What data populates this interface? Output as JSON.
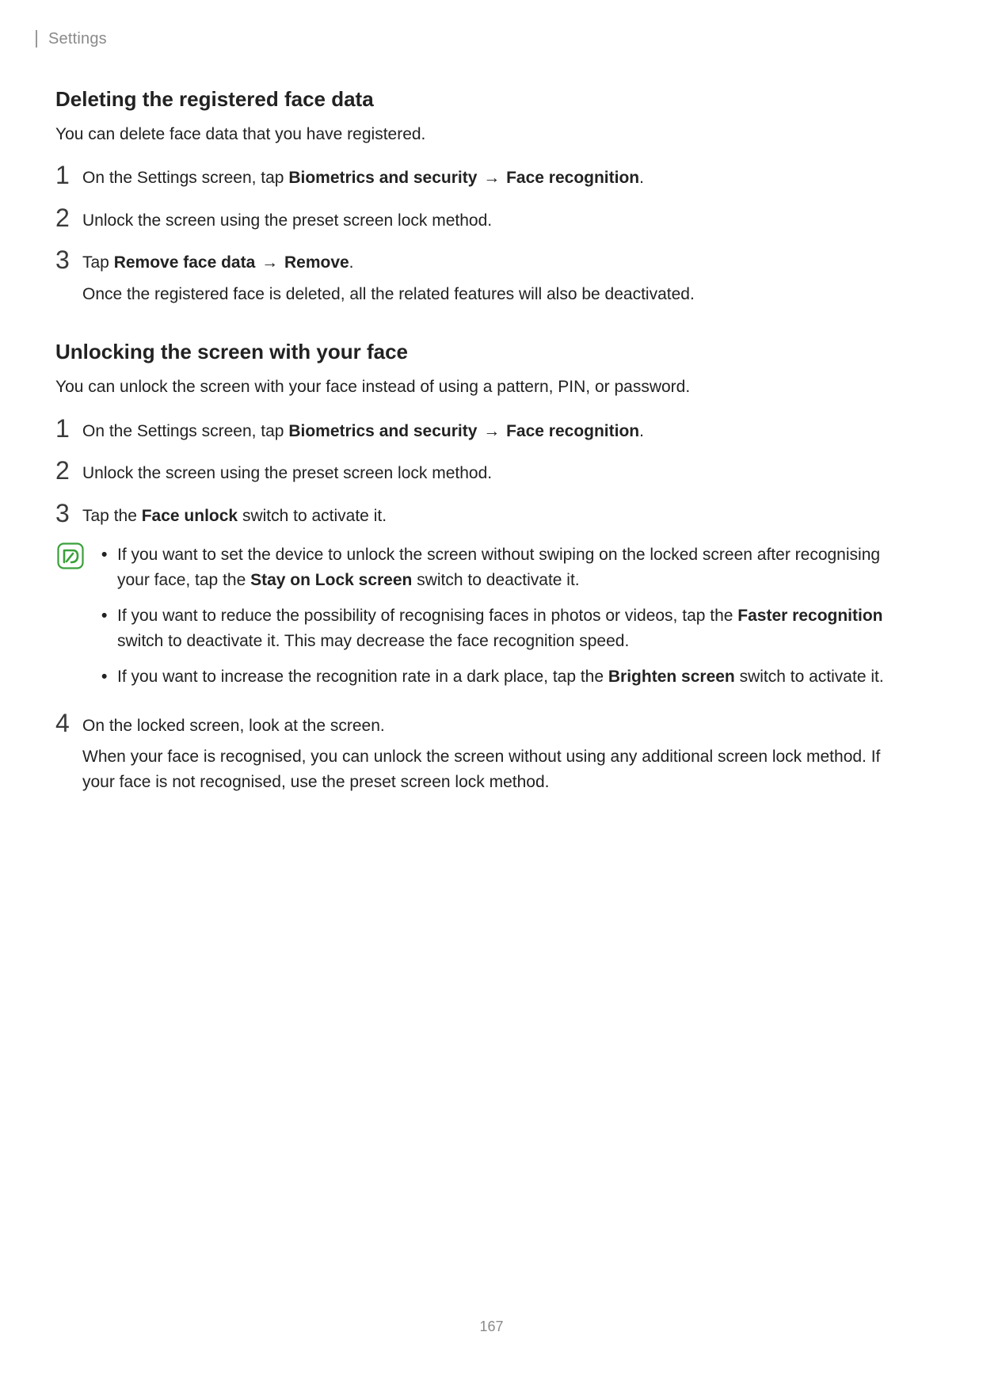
{
  "header": {
    "breadcrumb": "Settings"
  },
  "section1": {
    "title": "Deleting the registered face data",
    "intro": "You can delete face data that you have registered.",
    "steps": {
      "s1": {
        "num": "1",
        "pre": "On the Settings screen, tap ",
        "b1": "Biometrics and security",
        "arrow": " → ",
        "b2": "Face recognition",
        "post": "."
      },
      "s2": {
        "num": "2",
        "text": "Unlock the screen using the preset screen lock method."
      },
      "s3": {
        "num": "3",
        "pre": "Tap ",
        "b1": "Remove face data",
        "arrow": " → ",
        "b2": "Remove",
        "post": ".",
        "extra": "Once the registered face is deleted, all the related features will also be deactivated."
      }
    }
  },
  "section2": {
    "title": "Unlocking the screen with your face",
    "intro": "You can unlock the screen with your face instead of using a pattern, PIN, or password.",
    "steps": {
      "s1": {
        "num": "1",
        "pre": "On the Settings screen, tap ",
        "b1": "Biometrics and security",
        "arrow": " → ",
        "b2": "Face recognition",
        "post": "."
      },
      "s2": {
        "num": "2",
        "text": "Unlock the screen using the preset screen lock method."
      },
      "s3": {
        "num": "3",
        "pre": "Tap the ",
        "b1": "Face unlock",
        "post": " switch to activate it."
      },
      "note": {
        "n1": {
          "pre": "If you want to set the device to unlock the screen without swiping on the locked screen after recognising your face, tap the ",
          "b": "Stay on Lock screen",
          "post": " switch to deactivate it."
        },
        "n2": {
          "pre": "If you want to reduce the possibility of recognising faces in photos or videos, tap the ",
          "b": "Faster recognition",
          "post": " switch to deactivate it. This may decrease the face recognition speed."
        },
        "n3": {
          "pre": "If you want to increase the recognition rate in a dark place, tap the ",
          "b": "Brighten screen",
          "post": " switch to activate it."
        }
      },
      "s4": {
        "num": "4",
        "text": "On the locked screen, look at the screen.",
        "extra": "When your face is recognised, you can unlock the screen without using any additional screen lock method. If your face is not recognised, use the preset screen lock method."
      }
    }
  },
  "pageNumber": "167",
  "bulletChar": "•"
}
